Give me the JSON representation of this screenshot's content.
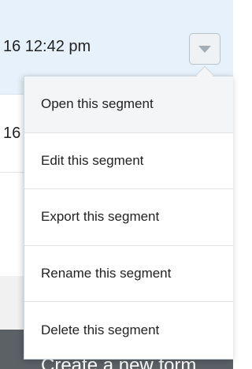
{
  "row_top": {
    "date_text": "16 12:42 pm"
  },
  "row_second": {
    "text": "16"
  },
  "bottom_bar": {
    "text": "Create a new form"
  },
  "menu": {
    "items": [
      {
        "label": "Open this segment"
      },
      {
        "label": "Edit this segment"
      },
      {
        "label": "Export this segment"
      },
      {
        "label": "Rename this segment"
      },
      {
        "label": "Delete this segment"
      }
    ]
  },
  "colors": {
    "row_highlight": "#e6f1fb",
    "bottom_bar": "#5c6166",
    "toggle_bg": "#eef2f5"
  },
  "icons": {
    "toggle": "chevron-down-icon"
  }
}
